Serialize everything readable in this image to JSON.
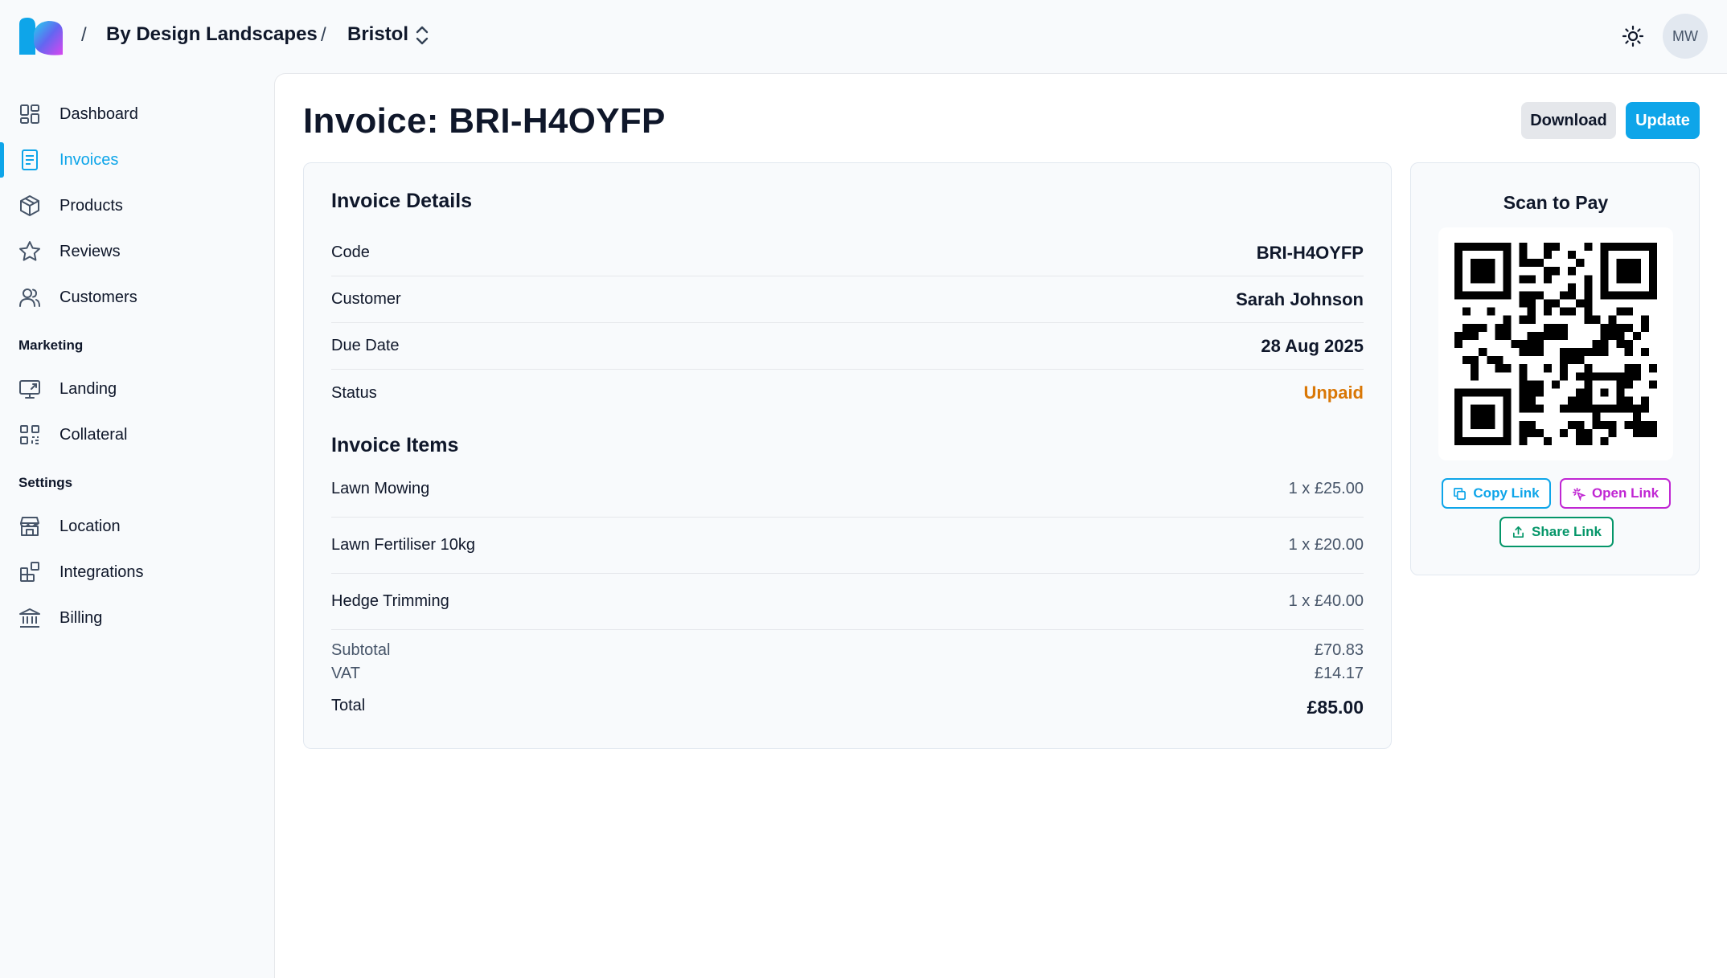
{
  "header": {
    "org": "By Design Landscapes",
    "location": "Bristol",
    "separator": "/",
    "avatar_initials": "MW",
    "icons": [
      "logo",
      "chevron-up-down-icon",
      "sun-icon"
    ]
  },
  "sidebar": {
    "items": [
      {
        "label": "Dashboard",
        "icon": "dashboard-icon",
        "active": false
      },
      {
        "label": "Invoices",
        "icon": "invoice-icon",
        "active": true
      },
      {
        "label": "Products",
        "icon": "box-icon",
        "active": false
      },
      {
        "label": "Reviews",
        "icon": "star-icon",
        "active": false
      },
      {
        "label": "Customers",
        "icon": "users-icon",
        "active": false
      }
    ],
    "marketing_title": "Marketing",
    "marketing": [
      {
        "label": "Landing",
        "icon": "monitor-icon"
      },
      {
        "label": "Collateral",
        "icon": "qr-code-icon"
      }
    ],
    "settings_title": "Settings",
    "settings": [
      {
        "label": "Location",
        "icon": "store-icon"
      },
      {
        "label": "Integrations",
        "icon": "puzzle-icon"
      },
      {
        "label": "Billing",
        "icon": "bank-icon"
      }
    ]
  },
  "main": {
    "title": "Invoice: BRI-H4OYFP",
    "download_label": "Download",
    "update_label": "Update"
  },
  "details": {
    "title": "Invoice Details",
    "fields": [
      {
        "key": "Code",
        "value": "BRI-H4OYFP"
      },
      {
        "key": "Customer",
        "value": "Sarah Johnson"
      },
      {
        "key": "Due Date",
        "value": "28 Aug 2025"
      },
      {
        "key": "Status",
        "value": "Unpaid"
      }
    ],
    "items_title": "Invoice Items",
    "items": [
      {
        "name": "Lawn Mowing",
        "qty": "1 x £25.00"
      },
      {
        "name": "Lawn Fertiliser 10kg",
        "qty": "1 x £20.00"
      },
      {
        "name": "Hedge Trimming",
        "qty": "1 x £40.00"
      }
    ],
    "subtotal_label": "Subtotal",
    "subtotal": "£70.83",
    "vat_label": "VAT",
    "vat": "£14.17",
    "total_label": "Total",
    "total": "£85.00"
  },
  "pay": {
    "title": "Scan to Pay",
    "copy_label": "Copy Link",
    "open_label": "Open Link",
    "share_label": "Share Link"
  },
  "colors": {
    "accent": "#0ea5e9",
    "status_unpaid": "#d97706",
    "open_link": "#c026d3",
    "share_link": "#059669"
  }
}
